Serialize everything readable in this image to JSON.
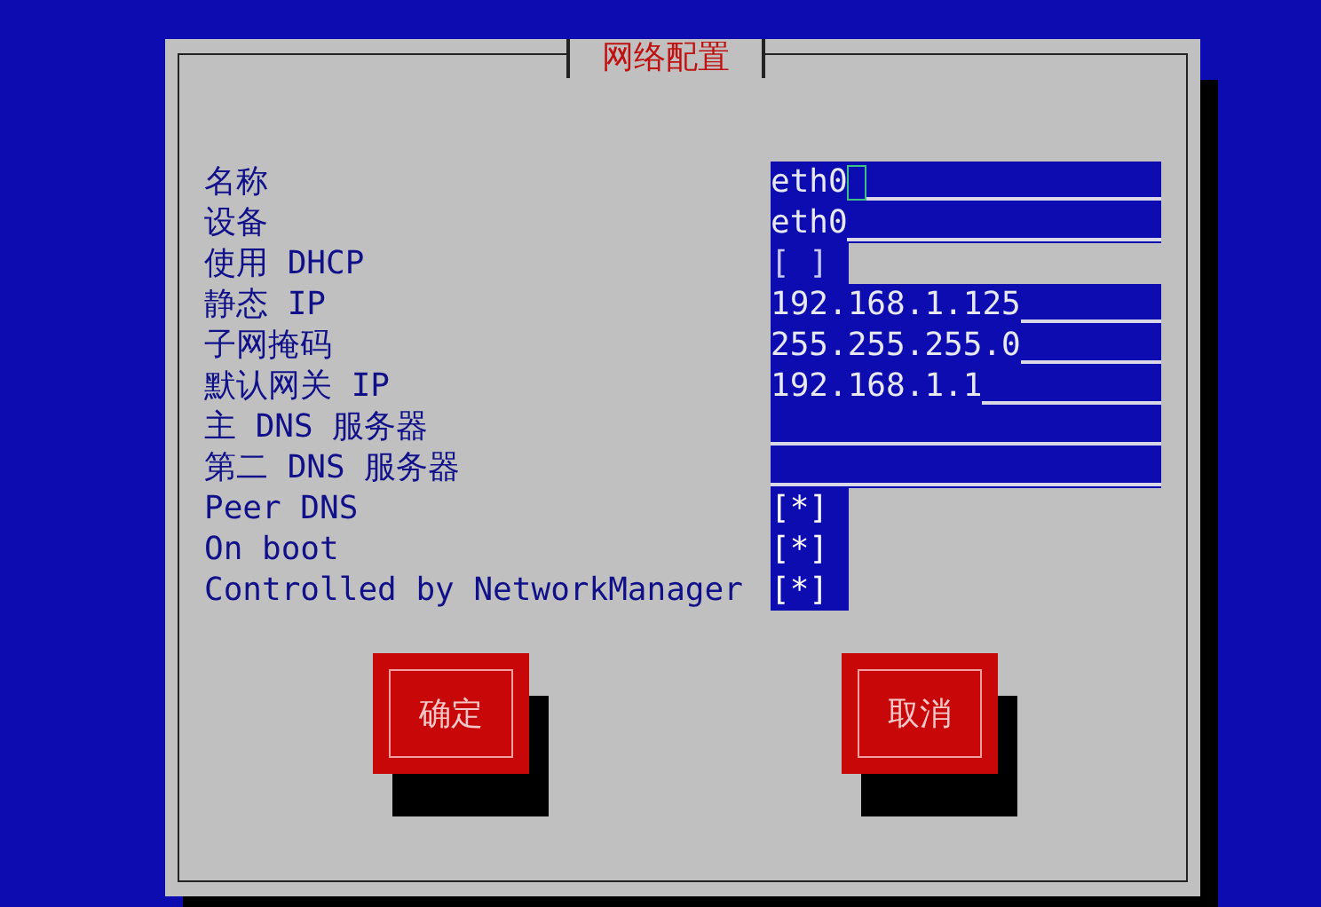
{
  "dialog": {
    "title": "网络配置"
  },
  "fields": [
    {
      "kind": "text",
      "label": "名称",
      "value": "eth0",
      "focused": true
    },
    {
      "kind": "text",
      "label": "设备",
      "value": "eth0",
      "focused": false
    },
    {
      "kind": "checkbox",
      "label": "使用 DHCP",
      "mark": "[ ]",
      "checked": false
    },
    {
      "kind": "text",
      "label": "静态 IP",
      "value": "192.168.1.125",
      "focused": false
    },
    {
      "kind": "text",
      "label": "子网掩码",
      "value": "255.255.255.0",
      "focused": false
    },
    {
      "kind": "text",
      "label": "默认网关 IP",
      "value": "192.168.1.1",
      "focused": false
    },
    {
      "kind": "text",
      "label": "主 DNS 服务器",
      "focused": false
    },
    {
      "kind": "text",
      "label": "第二 DNS 服务器",
      "focused": false
    },
    {
      "kind": "checkbox",
      "label": "Peer DNS",
      "mark": "[*]",
      "checked": true
    },
    {
      "kind": "checkbox",
      "label": "On boot",
      "mark": "[*]",
      "checked": true
    },
    {
      "kind": "checkbox",
      "label": "Controlled by NetworkManager",
      "mark": "[*]",
      "checked": true
    }
  ],
  "buttons": [
    "确定",
    "取消"
  ]
}
